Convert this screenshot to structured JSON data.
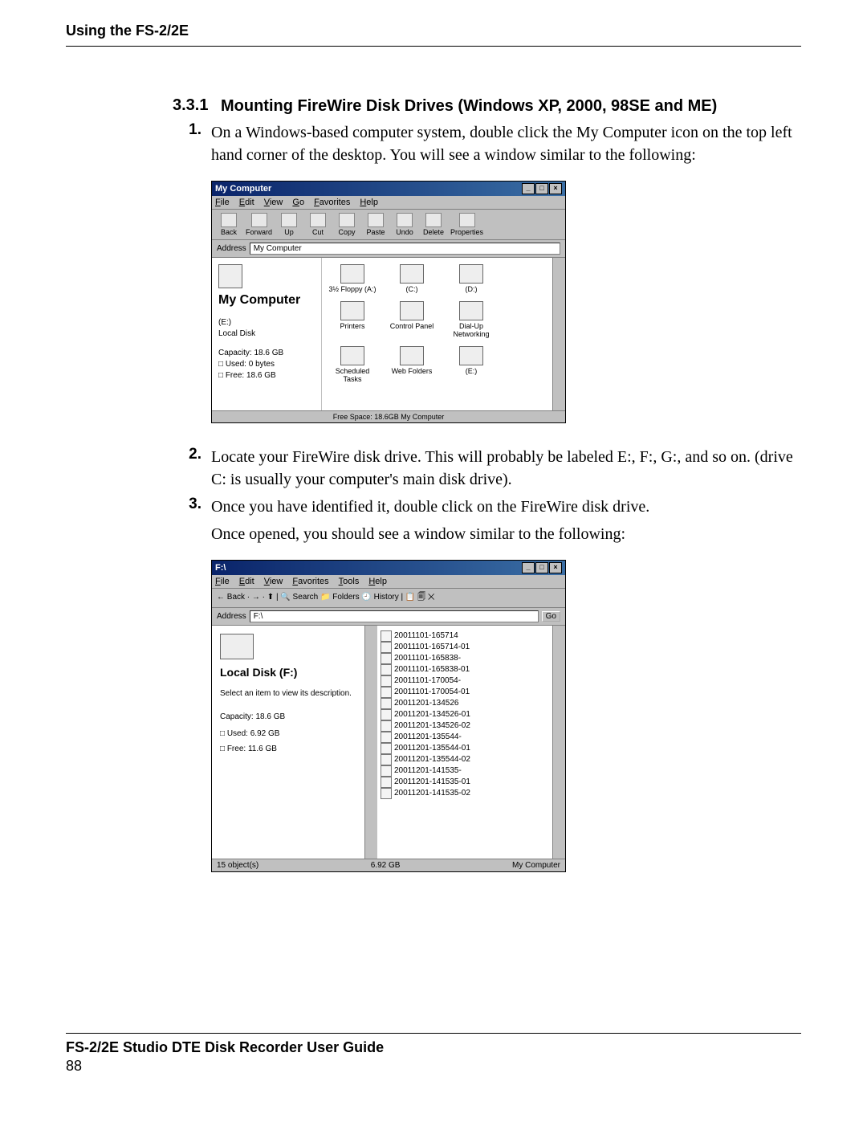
{
  "header": "Using the FS-2/2E",
  "section": {
    "number": "3.3.1",
    "title": "Mounting FireWire Disk Drives (Windows XP, 2000, 98SE and ME)"
  },
  "steps": {
    "s1": {
      "num": "1.",
      "text": "On a Windows-based computer system, double click the My Computer icon on the top left hand corner of the desktop. You will see a window similar to the following:"
    },
    "s2": {
      "num": "2.",
      "text": "Locate your FireWire disk drive. This will probably be labeled E:, F:, G:, and so on. (drive C: is usually your computer's main disk drive)."
    },
    "s3": {
      "num": "3.",
      "text": "Once you have identified it, double click on the FireWire disk drive."
    },
    "s3b": "Once opened, you should see a window similar to the following:"
  },
  "shot1": {
    "title": "My Computer",
    "menus": {
      "m0": "File",
      "m1": "Edit",
      "m2": "View",
      "m3": "Go",
      "m4": "Favorites",
      "m5": "Help"
    },
    "tools": {
      "t0": "Back",
      "t1": "Forward",
      "t2": "Up",
      "t3": "Cut",
      "t4": "Copy",
      "t5": "Paste",
      "t6": "Undo",
      "t7": "Delete",
      "t8": "Properties"
    },
    "addr_label": "Address",
    "addr_value": "My Computer",
    "left_title": "My Computer",
    "left_sel": "(E:)\nLocal Disk",
    "left_cap": "Capacity: 18.6 GB",
    "left_used": "Used: 0 bytes",
    "left_free": "Free: 18.6 GB",
    "icons": {
      "i0": "3½ Floppy (A:)",
      "i1": "(C:)",
      "i2": "(D:)",
      "i3": "Printers",
      "i4": "Control Panel",
      "i5": "Dial-Up Networking",
      "i6": "Scheduled Tasks",
      "i7": "Web Folders",
      "i8": "(E:)"
    },
    "status": "Free Space: 18.6GB    My Computer"
  },
  "shot2": {
    "title": "F:\\",
    "menus": {
      "m0": "File",
      "m1": "Edit",
      "m2": "View",
      "m3": "Favorites",
      "m4": "Tools",
      "m5": "Help"
    },
    "toolrow": "← Back  ·  →  ·  ⬆   | 🔍 Search   📁 Folders   🕘 History   |  📋 🗐 ✕",
    "addr_label": "Address",
    "addr_value": "F:\\",
    "go": "Go",
    "left_title": "Local Disk (F:)",
    "left_hint": "Select an item to view its description.",
    "left_cap": "Capacity: 18.6 GB",
    "left_used": "Used: 6.92 GB",
    "left_free": "Free: 11.6 GB",
    "files": {
      "f0": "20011101-165714",
      "f1": "20011101-165714-01",
      "f2": "20011101-165838-",
      "f3": "20011101-165838-01",
      "f4": "20011101-170054-",
      "f5": "20011101-170054-01",
      "f6": "20011201-134526",
      "f7": "20011201-134526-01",
      "f8": "20011201-134526-02",
      "f9": "20011201-135544-",
      "f10": "20011201-135544-01",
      "f11": "20011201-135544-02",
      "f12": "20011201-141535-",
      "f13": "20011201-141535-01",
      "f14": "20011201-141535-02"
    },
    "status_left": "15 object(s)",
    "status_mid": "6.92 GB",
    "status_right": "My Computer"
  },
  "footer": {
    "line1": "FS-2/2E Studio DTE Disk Recorder User Guide",
    "line2": "88"
  }
}
